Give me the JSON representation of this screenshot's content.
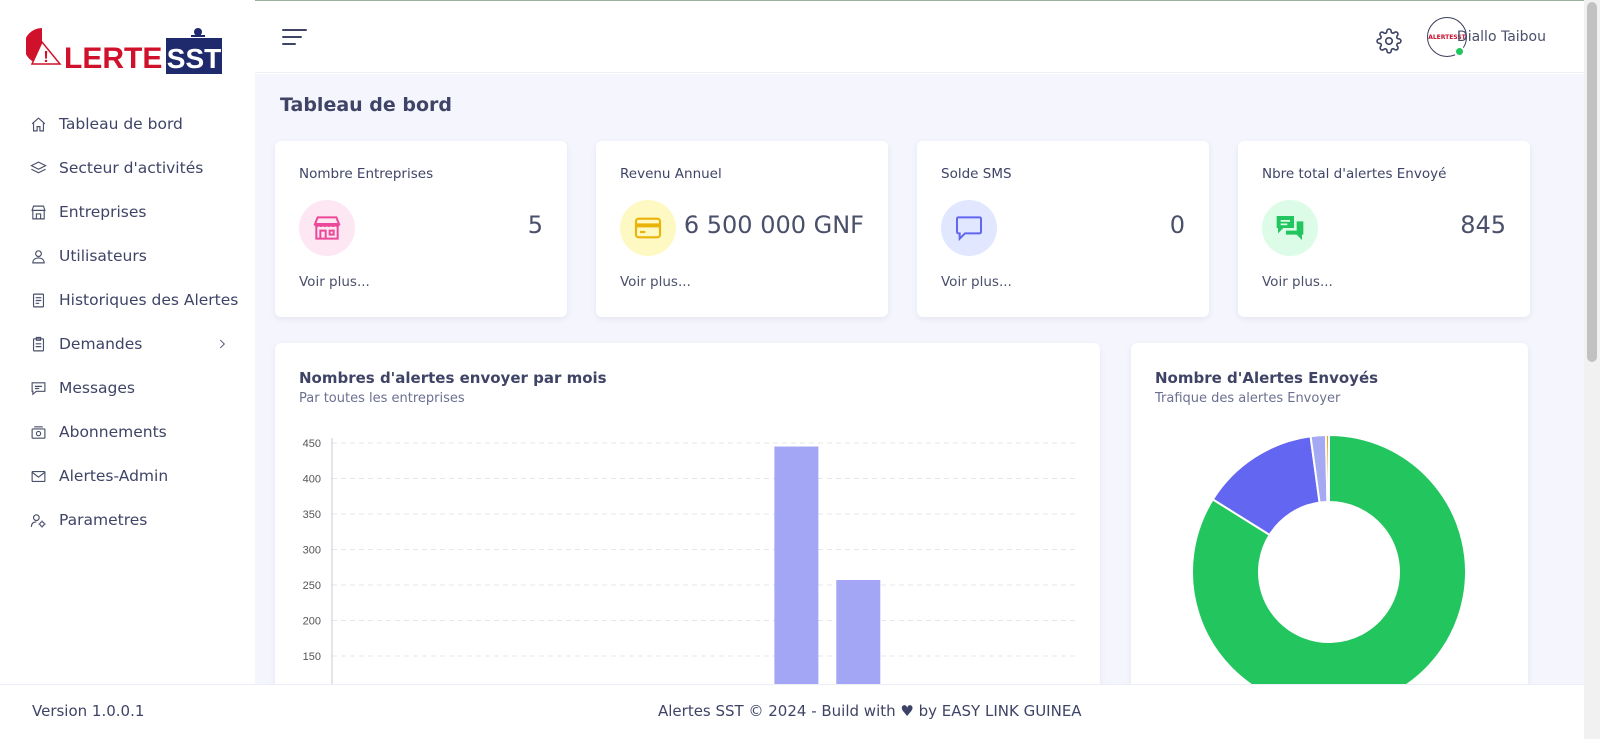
{
  "brand": {
    "logo_prefix": "!",
    "logo_word": "LERTE",
    "logo_suffix": "SST"
  },
  "sidebar": {
    "items": [
      {
        "label": "Tableau de bord",
        "icon": "home-icon"
      },
      {
        "label": "Secteur d'activités",
        "icon": "layers-icon"
      },
      {
        "label": "Entreprises",
        "icon": "building-icon"
      },
      {
        "label": "Utilisateurs",
        "icon": "user-icon"
      },
      {
        "label": "Historiques des Alertes",
        "icon": "document-icon"
      },
      {
        "label": "Demandes",
        "icon": "clipboard-icon"
      },
      {
        "label": "Messages",
        "icon": "message-icon"
      },
      {
        "label": "Abonnements",
        "icon": "subscription-icon"
      },
      {
        "label": "Alertes-Admin",
        "icon": "mail-icon"
      },
      {
        "label": "Parametres",
        "icon": "user-gear-icon"
      }
    ]
  },
  "header": {
    "user_name": "Diallo Taibou",
    "avatar_text": "ALERTESST"
  },
  "main": {
    "page_title": "Tableau de bord",
    "stats": [
      {
        "title": "Nombre Entreprises",
        "value": "5",
        "link": "Voir plus...",
        "icon": "store-icon",
        "color": "#ec4899",
        "bg": "#fce7f3"
      },
      {
        "title": "Revenu Annuel",
        "value": "6 500 000 GNF",
        "link": "Voir plus...",
        "icon": "credit-card-icon",
        "color": "#eab308",
        "bg": "#fef9c3"
      },
      {
        "title": "Solde SMS",
        "value": "0",
        "link": "Voir plus...",
        "icon": "chat-bubble-icon",
        "color": "#6366f1",
        "bg": "#e0e7ff"
      },
      {
        "title": "Nbre total d'alertes Envoyé",
        "value": "845",
        "link": "Voir plus...",
        "icon": "chat-bubbles-icon",
        "color": "#22c55e",
        "bg": "#dcfce7"
      }
    ],
    "bar_panel": {
      "title": "Nombres d'alertes envoyer par mois",
      "subtitle": "Par toutes les entreprises"
    },
    "donut_panel": {
      "title": "Nombre d'Alertes Envoyés",
      "subtitle": "Trafique des alertes Envoyer"
    }
  },
  "chart_data": [
    {
      "type": "bar",
      "yticks": [
        150,
        200,
        250,
        300,
        350,
        400,
        450
      ],
      "ylim": [
        0,
        450
      ],
      "color": "#a3a6f5",
      "series": [
        {
          "values": [
            0,
            0,
            0,
            0,
            0,
            0,
            0,
            445,
            257,
            0,
            0,
            0
          ]
        }
      ]
    },
    {
      "type": "pie",
      "values": [
        703,
        117,
        15,
        3
      ],
      "colors": [
        "#22c55e",
        "#6366f1",
        "#a5a8f3",
        "#f59e0b"
      ]
    }
  ],
  "footer": {
    "version": "Version 1.0.0.1",
    "copyright": "Alertes SST © 2024 - Build with ♥ by EASY LINK GUINEA"
  }
}
